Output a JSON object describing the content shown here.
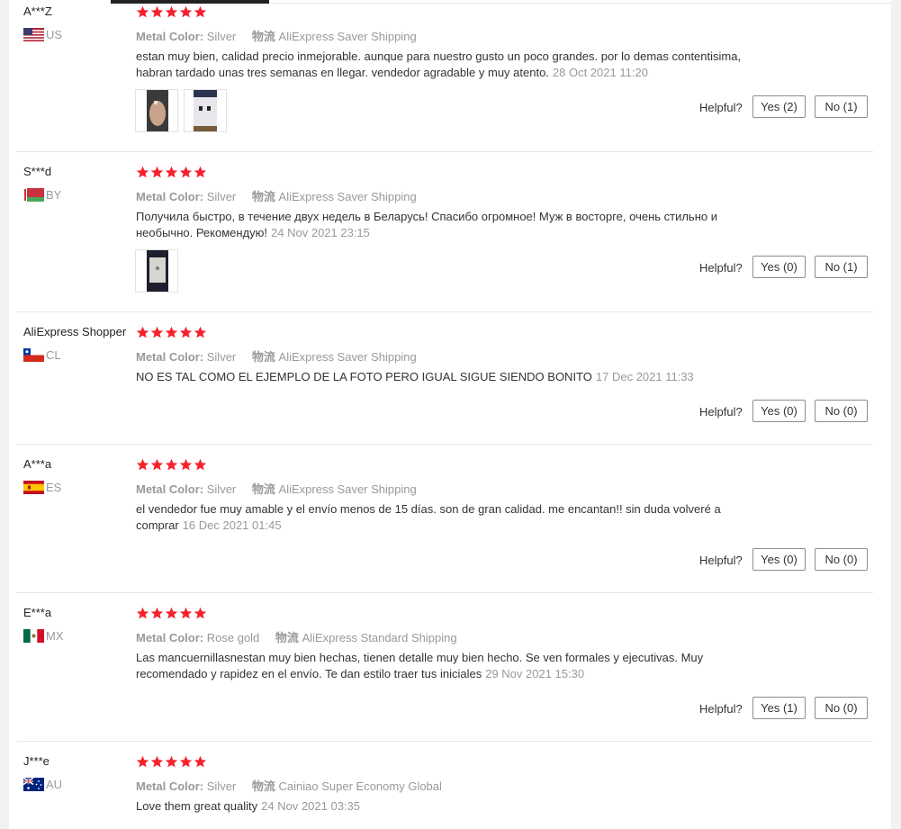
{
  "labels": {
    "metal_color_key": "Metal Color:",
    "shipping_key": "物流",
    "helpful": "Helpful?"
  },
  "colors": {
    "star": "#f5222d",
    "text": "#333333",
    "muted": "#999999"
  },
  "reviews": [
    {
      "user": "A***Z",
      "country": "US",
      "rating": 5,
      "metal_color": "Silver",
      "shipping": "AliExpress Saver Shipping",
      "text": "estan muy bien, calidad precio inmejorable. aunque para nuestro gusto un poco grandes. por lo demas contentisima, habran tardado unas tres semanas en llegar. vendedor agradable y muy atento.",
      "date": "28 Oct 2021 11:20",
      "yes_label": "Yes (2)",
      "no_label": "No (1)",
      "photos": 2
    },
    {
      "user": "S***d",
      "country": "BY",
      "rating": 5,
      "metal_color": "Silver",
      "shipping": "AliExpress Saver Shipping",
      "text": "Получила быстро, в течение двух недель в Беларусь! Спасибо огромное! Муж в восторге, очень стильно и необычно. Рекомендую!",
      "date": "24 Nov 2021 23:15",
      "yes_label": "Yes (0)",
      "no_label": "No (1)",
      "photos": 1
    },
    {
      "user": "AliExpress Shopper",
      "country": "CL",
      "rating": 5,
      "metal_color": "Silver",
      "shipping": "AliExpress Saver Shipping",
      "text": "NO ES TAL COMO EL EJEMPLO DE LA FOTO PERO IGUAL SIGUE SIENDO BONITO",
      "date": "17 Dec 2021 11:33",
      "yes_label": "Yes (0)",
      "no_label": "No (0)",
      "photos": 0
    },
    {
      "user": "A***a",
      "country": "ES",
      "rating": 5,
      "metal_color": "Silver",
      "shipping": "AliExpress Saver Shipping",
      "text": "el vendedor fue muy amable y el envío menos de 15 días. son de gran calidad. me encantan!! sin duda volveré a comprar",
      "date": "16 Dec 2021 01:45",
      "yes_label": "Yes (0)",
      "no_label": "No (0)",
      "photos": 0
    },
    {
      "user": "E***a",
      "country": "MX",
      "rating": 5,
      "metal_color": "Rose gold",
      "shipping": "AliExpress Standard Shipping",
      "text": "Las mancuernillasnestan muy bien hechas, tienen detalle muy bien hecho. Se ven formales y ejecutivas. Muy recomendado y rapidez en el envío. Te dan estilo traer tus iniciales",
      "date": "29 Nov 2021 15:30",
      "yes_label": "Yes (1)",
      "no_label": "No (0)",
      "photos": 0
    },
    {
      "user": "J***e",
      "country": "AU",
      "rating": 5,
      "metal_color": "Silver",
      "shipping": "Cainiao Super Economy Global",
      "text": "Love them great quality",
      "date": "24 Nov 2021 03:35",
      "photos": 0
    }
  ]
}
